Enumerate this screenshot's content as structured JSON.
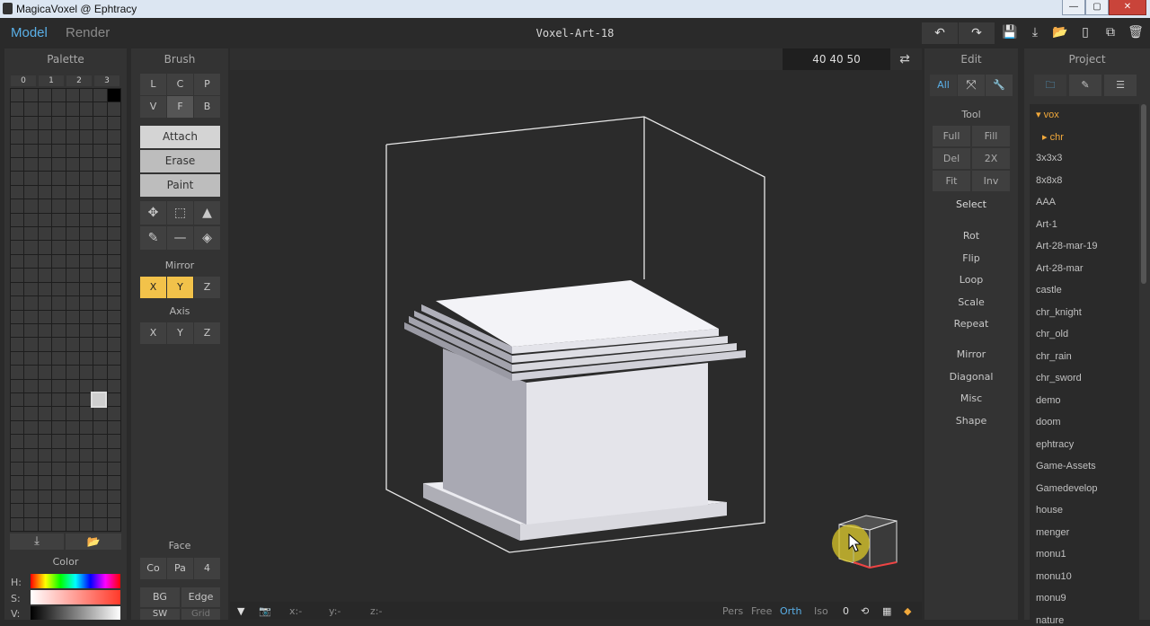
{
  "window": {
    "title": "MagicaVoxel @ Ephtracy",
    "minimize": "—",
    "maximize": "▢",
    "close": "✕"
  },
  "app": {
    "mode_model": "Model",
    "mode_render": "Render",
    "doc_title": "Voxel-Art-18"
  },
  "toolbar": {
    "undo": "↶",
    "redo": "↷",
    "save": "💾",
    "export": "⤓",
    "open": "📂",
    "new": "▯",
    "copy": "⧉",
    "delete": "🗑"
  },
  "palette": {
    "title": "Palette",
    "tabs": [
      "0",
      "1",
      "2",
      "3"
    ],
    "save_icon": "⤓",
    "open_icon": "📂"
  },
  "brush": {
    "title": "Brush",
    "shapes_row1": [
      "L",
      "C",
      "P"
    ],
    "shapes_row2": [
      "V",
      "F",
      "B"
    ],
    "modes": [
      "Attach",
      "Erase",
      "Paint"
    ],
    "tools_row1": [
      "✥",
      "⬚",
      "▲"
    ],
    "tools_row2": [
      "✎",
      "—",
      "◈"
    ],
    "mirror_label": "Mirror",
    "mirror": [
      "X",
      "Y",
      "Z"
    ],
    "axis_label": "Axis",
    "axis": [
      "X",
      "Y",
      "Z"
    ],
    "face_label": "Face",
    "face": [
      "Co",
      "Pa",
      "4"
    ],
    "bg": "BG",
    "edge": "Edge",
    "sw": "SW",
    "grid": "Grid"
  },
  "color": {
    "title": "Color",
    "h": "H:",
    "s": "S:",
    "v": "V:"
  },
  "viewport": {
    "dims": "40  40  50",
    "swap": "⇄"
  },
  "bottom": {
    "coord_x": "x:-",
    "coord_y": "y:-",
    "coord_z": "z:-",
    "pers": "Pers",
    "free": "Free",
    "orth": "Orth",
    "iso": "Iso",
    "zoom": "0"
  },
  "edit": {
    "title": "Edit",
    "tabs": [
      "All",
      "⤧",
      "🔧"
    ],
    "tool_label": "Tool",
    "tool_grid": [
      [
        "Full",
        "Fill"
      ],
      [
        "Del",
        "2X"
      ],
      [
        "Fit",
        "Inv"
      ]
    ],
    "select": "Select",
    "actions": [
      "Rot",
      "Flip",
      "Loop",
      "Scale",
      "Repeat"
    ],
    "more": [
      "Mirror",
      "Diagonal",
      "Misc",
      "Shape"
    ]
  },
  "project": {
    "title": "Project",
    "items": [
      "▾ vox",
      "▸ chr",
      "3x3x3",
      "8x8x8",
      "AAA",
      "Art-1",
      "Art-28-mar-19",
      "Art-28-mar",
      "castle",
      "chr_knight",
      "chr_old",
      "chr_rain",
      "chr_sword",
      "demo",
      "doom",
      "ephtracy",
      "Game-Assets",
      "Gamedevelop",
      "house",
      "menger",
      "monu1",
      "monu10",
      "monu9",
      "nature"
    ]
  },
  "colors": {
    "accent": "#5ab0e8",
    "mirror_active": "#f2c24a",
    "folder": "#f2a93b"
  }
}
